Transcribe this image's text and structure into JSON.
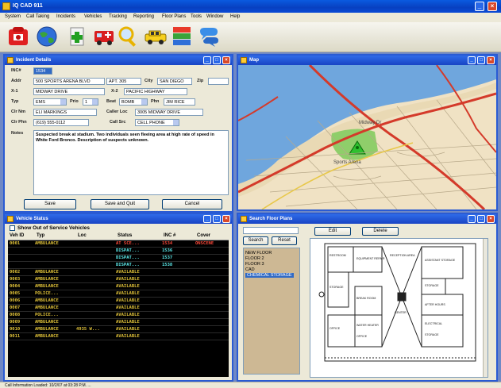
{
  "window": {
    "title": "IQ CAD 911"
  },
  "menu": [
    "System",
    "Call Taking",
    "Incidents",
    "Vehicles",
    "Tracking",
    "Reporting",
    "Floor Plans",
    "Tools",
    "Window",
    "Help"
  ],
  "toolbar": [
    "phone-icon",
    "globe-icon",
    "add-incident-icon",
    "ambulance-icon",
    "search-icon",
    "vehicle-icon",
    "status-board-icon",
    "chat-icon"
  ],
  "incident": {
    "title": "Incident Details",
    "fields": {
      "inc_label": "INC#",
      "inc_value": "1534",
      "addr_label": "Addr",
      "addr_value": "500 SPORTS ARENA BLVD",
      "apt_value": "APT. 305",
      "city_label": "City",
      "city_value": "SAN DIEGO",
      "zip_label": "Zip",
      "zip_value": "",
      "x1_label": "X-1",
      "x1_value": "MIDWAY DRIVE",
      "x2_label": "X-2",
      "x2_value": "PACIFIC HIGHWAY",
      "type_label": "Typ",
      "type_value": "EMS",
      "pri_label": "Prio",
      "pri_value": "1",
      "beat_label": "Beat",
      "beat_value": "BOMB",
      "phone_label": "Phn",
      "phone_value": "JIM RICE",
      "clr_name_label": "Clr Nm",
      "clr_name_value": "ELI MARKINGS",
      "caller_loc_label": "Caller Loc",
      "caller_loc_value": "3005 MIDWAY DRIVE",
      "clr_ph_label": "Clr Phn",
      "clr_ph_value": "(619) 555-0112",
      "call_src_label": "Call Src",
      "call_src_value": "CELL PHONE",
      "notes_label": "Notes",
      "notes_value": "Suspected break at stadium. Two individuals seen fleeing area at high rate of speed in White Ford Bronco. Description of suspects unknown."
    },
    "buttons": {
      "save": "Save",
      "save_quit": "Save and Quit",
      "cancel": "Cancel"
    }
  },
  "map": {
    "title": "Map",
    "labels": [
      "Midway Dr",
      "Sports Arena"
    ]
  },
  "vehicles": {
    "title": "Vehicle Status",
    "show_oos": "Show Out of Service Vehicles",
    "headers": [
      "Veh ID",
      "Typ",
      "Loc",
      "Status",
      "INC #",
      "Cover"
    ],
    "rows": [
      {
        "id": "0001",
        "type": "AMBULANCE",
        "loc": "",
        "status": "AT SCE...",
        "inc": "1534",
        "cover": "ONSCENE",
        "hl": "red"
      },
      {
        "id": "",
        "type": "",
        "loc": "",
        "status": "DISPAT...",
        "inc": "1536",
        "cover": "",
        "hl": "cyan"
      },
      {
        "id": "",
        "type": "",
        "loc": "",
        "status": "DISPAT...",
        "inc": "1537",
        "cover": "",
        "hl": "cyan"
      },
      {
        "id": "",
        "type": "",
        "loc": "",
        "status": "DISPAT...",
        "inc": "1538",
        "cover": "",
        "hl": "cyan"
      },
      {
        "id": "0002",
        "type": "AMBULANCE",
        "loc": "",
        "status": "AVAILABLE",
        "inc": "",
        "cover": "",
        "hl": ""
      },
      {
        "id": "0003",
        "type": "AMBULANCE",
        "loc": "",
        "status": "AVAILABLE",
        "inc": "",
        "cover": "",
        "hl": ""
      },
      {
        "id": "0004",
        "type": "AMBULANCE",
        "loc": "",
        "status": "AVAILABLE",
        "inc": "",
        "cover": "",
        "hl": ""
      },
      {
        "id": "0005",
        "type": "POLICE...",
        "loc": "",
        "status": "AVAILABLE",
        "inc": "",
        "cover": "",
        "hl": ""
      },
      {
        "id": "0006",
        "type": "AMBULANCE",
        "loc": "",
        "status": "AVAILABLE",
        "inc": "",
        "cover": "",
        "hl": ""
      },
      {
        "id": "0007",
        "type": "AMBULANCE",
        "loc": "",
        "status": "AVAILABLE",
        "inc": "",
        "cover": "",
        "hl": ""
      },
      {
        "id": "0008",
        "type": "POLICE...",
        "loc": "",
        "status": "AVAILABLE",
        "inc": "",
        "cover": "",
        "hl": ""
      },
      {
        "id": "0009",
        "type": "AMBULANCE",
        "loc": "",
        "status": "AVAILABLE",
        "inc": "",
        "cover": "",
        "hl": ""
      },
      {
        "id": "0010",
        "type": "AMBULANCE",
        "loc": "4935 W...",
        "status": "AVAILABLE",
        "inc": "",
        "cover": "",
        "hl": ""
      },
      {
        "id": "0011",
        "type": "AMBULANCE",
        "loc": "",
        "status": "AVAILABLE",
        "inc": "",
        "cover": "",
        "hl": ""
      }
    ]
  },
  "floorplans": {
    "title": "Search Floor Plans",
    "search_value": "",
    "search_btn": "Search",
    "reset_btn": "Reset",
    "edit_btn": "Edit",
    "delete_btn": "Delete",
    "items": [
      "NEW FLOOR",
      "FLOOR 2",
      "FLOOR 3",
      "CAD",
      "CHEMICAL STORAGE"
    ],
    "selected": 4,
    "rooms": [
      "RESTROOM",
      "EQUIPMENT REPAIR",
      "RECEPTION AREA",
      "ASSISTANT STORAGE",
      "STORAGE",
      "BREAK ROOM",
      "CENTER",
      "STORAGE",
      "AFTER HOURS",
      "OFFICE",
      "WATER HEATER",
      "OFFICE",
      "ELECTRICAL",
      "STORAGE"
    ]
  },
  "statusbar": {
    "text": "Call Information Loaded: 10/2/07 at 03:28 P.M. ..."
  }
}
